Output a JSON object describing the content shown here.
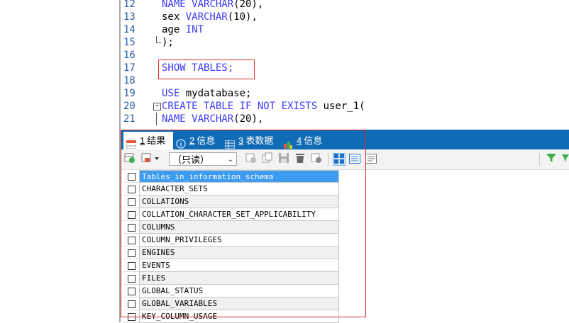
{
  "editor": {
    "lines": [
      {
        "num": "12",
        "tokens": [
          {
            "t": "NAME ",
            "k": "kw"
          },
          {
            "t": "VARCHAR",
            "k": "kw"
          },
          {
            "t": "(20),",
            "k": "tx"
          }
        ]
      },
      {
        "num": "13",
        "tokens": [
          {
            "t": "sex ",
            "k": "tx"
          },
          {
            "t": "VARCHAR",
            "k": "kw"
          },
          {
            "t": "(10),",
            "k": "tx"
          }
        ]
      },
      {
        "num": "14",
        "tokens": [
          {
            "t": "age ",
            "k": "tx"
          },
          {
            "t": "INT",
            "k": "kw"
          }
        ]
      },
      {
        "num": "15",
        "tokens": [
          {
            "t": ");",
            "k": "tx"
          }
        ]
      },
      {
        "num": "16",
        "tokens": []
      },
      {
        "num": "17",
        "tokens": [
          {
            "t": "SHOW TABLES;",
            "k": "kw"
          }
        ]
      },
      {
        "num": "18",
        "tokens": []
      },
      {
        "num": "19",
        "tokens": [
          {
            "t": "USE ",
            "k": "kw"
          },
          {
            "t": "mydatabase;",
            "k": "tx"
          }
        ]
      },
      {
        "num": "20",
        "tokens": [
          {
            "t": "CREATE TABLE IF NOT EXISTS ",
            "k": "kw"
          },
          {
            "t": "user_1(",
            "k": "tx"
          }
        ]
      },
      {
        "num": "21",
        "tokens": [
          {
            "t": "NAME ",
            "k": "kw"
          },
          {
            "t": "VARCHAR",
            "k": "kw"
          },
          {
            "t": "(20),",
            "k": "tx"
          }
        ]
      }
    ]
  },
  "tabs": [
    {
      "num": "1",
      "label": "结果",
      "icon": "result-grid-icon",
      "active": true
    },
    {
      "num": "2",
      "label": "信息",
      "icon": "info-icon",
      "active": false
    },
    {
      "num": "3",
      "label": "表数据",
      "icon": "table-data-icon",
      "active": false
    },
    {
      "num": "4",
      "label": "信息",
      "icon": "info-chart-icon",
      "active": false
    }
  ],
  "toolbar": {
    "mode_select_value": "（只读）"
  },
  "grid": {
    "header": "Tables_in_information_schema",
    "rows": [
      "CHARACTER_SETS",
      "COLLATIONS",
      "COLLATION_CHARACTER_SET_APPLICABILITY",
      "COLUMNS",
      "COLUMN_PRIVILEGES",
      "ENGINES",
      "EVENTS",
      "FILES",
      "GLOBAL_STATUS",
      "GLOBAL_VARIABLES",
      "KEY_COLUMN_USAGE"
    ]
  },
  "colors": {
    "keyword": "#3a3aff",
    "tabbar": "#0f6bb5",
    "grid_header": "#3d9bf0",
    "annotation_box": "#d9302a"
  }
}
